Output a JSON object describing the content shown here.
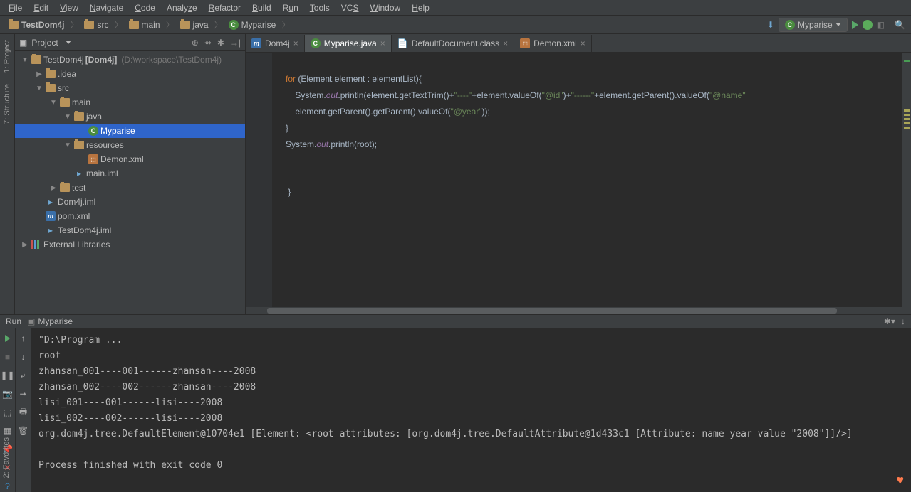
{
  "menu": {
    "file": "File",
    "edit": "Edit",
    "view": "View",
    "navigate": "Navigate",
    "code": "Code",
    "analyze": "Analyze",
    "refactor": "Refactor",
    "build": "Build",
    "run": "Run",
    "tools": "Tools",
    "vcs": "VCS",
    "window": "Window",
    "help": "Help"
  },
  "breadcrumb": {
    "items": [
      {
        "icon": "folder",
        "label": "TestDom4j"
      },
      {
        "icon": "folder",
        "label": "src"
      },
      {
        "icon": "folder",
        "label": "main"
      },
      {
        "icon": "folder",
        "label": "java"
      },
      {
        "icon": "class",
        "label": "Myparise"
      }
    ],
    "run_config": "Myparise"
  },
  "project": {
    "title": "Project",
    "tree": [
      {
        "d": 0,
        "arrow": "▼",
        "icon": "folder",
        "label": "TestDom4j",
        "extra": "[Dom4j]",
        "path": "(D:\\workspace\\TestDom4j)"
      },
      {
        "d": 1,
        "arrow": "▶",
        "icon": "folder",
        "label": ".idea"
      },
      {
        "d": 1,
        "arrow": "▼",
        "icon": "folder",
        "label": "src"
      },
      {
        "d": 2,
        "arrow": "▼",
        "icon": "folder",
        "label": "main"
      },
      {
        "d": 3,
        "arrow": "▼",
        "icon": "folder",
        "label": "java"
      },
      {
        "d": 4,
        "arrow": "",
        "icon": "class",
        "label": "Myparise",
        "sel": true
      },
      {
        "d": 3,
        "arrow": "▼",
        "icon": "folder",
        "label": "resources"
      },
      {
        "d": 4,
        "arrow": "",
        "icon": "xml",
        "label": "Demon.xml"
      },
      {
        "d": 3,
        "arrow": "",
        "icon": "file",
        "label": "main.iml"
      },
      {
        "d": 2,
        "arrow": "▶",
        "icon": "folder",
        "label": "test"
      },
      {
        "d": 1,
        "arrow": "",
        "icon": "file",
        "label": "Dom4j.iml"
      },
      {
        "d": 1,
        "arrow": "",
        "icon": "m",
        "label": "pom.xml"
      },
      {
        "d": 1,
        "arrow": "",
        "icon": "file",
        "label": "TestDom4j.iml"
      },
      {
        "d": 0,
        "arrow": "▶",
        "icon": "lib",
        "label": "External Libraries"
      }
    ]
  },
  "tabs": [
    {
      "icon": "m",
      "label": "Dom4j",
      "active": false
    },
    {
      "icon": "class",
      "label": "Myparise.java",
      "active": true
    },
    {
      "icon": "file",
      "label": "DefaultDocument.class",
      "active": false
    },
    {
      "icon": "xml",
      "label": "Demon.xml",
      "active": false
    }
  ],
  "code": {
    "l1a": "for",
    "l1b": " (Element element : elementList){",
    "l2a": "    System.",
    "l2b": "out",
    "l2c": ".println(element.getTextTrim()+",
    "l2d": "\"----\"",
    "l2e": "+element.valueOf(",
    "l2f": "\"@id\"",
    "l2g": ")+",
    "l2h": "\"------\"",
    "l2i": "+element.getParent().valueOf(",
    "l2j": "\"@name\"",
    "l3a": "    element.getParent().getParent().valueOf(",
    "l3b": "\"@year\"",
    "l3c": "));",
    "l4": "}",
    "l5a": "System.",
    "l5b": "out",
    "l5c": ".println(root);",
    "l6": "}",
    "l7": "}"
  },
  "run": {
    "title": "Run",
    "config": "Myparise",
    "lines": [
      "\"D:\\Program ...",
      "root",
      "zhansan_001----001------zhansan----2008",
      "zhansan_002----002------zhansan----2008",
      "lisi_001----001------lisi----2008",
      "lisi_002----002------lisi----2008",
      "org.dom4j.tree.DefaultElement@10704e1 [Element: <root attributes: [org.dom4j.tree.DefaultAttribute@1d433c1 [Attribute: name year value \"2008\"]]/>]",
      "",
      "Process finished with exit code 0"
    ]
  },
  "sidebars": {
    "project": "1: Project",
    "structure": "7: Structure",
    "favorites": "2: Favorites"
  }
}
